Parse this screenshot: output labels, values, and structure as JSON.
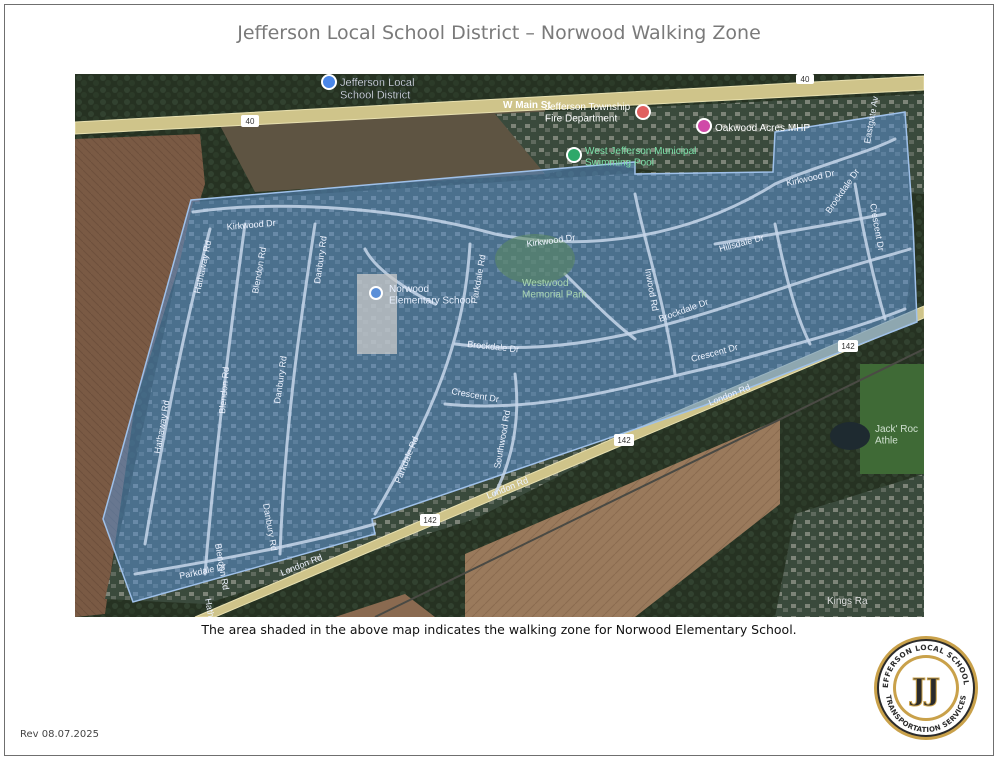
{
  "title": "Jefferson Local School District – Norwood Walking Zone",
  "caption": "The area shaded in the above map indicates the walking zone for Norwood Elementary School.",
  "revision": "Rev 08.07.2025",
  "map": {
    "poi": {
      "district": "Jefferson Local\nSchool District",
      "fire_dept": "Jefferson Township\nFire Department",
      "main_st": "W Main St",
      "oakwood": "Oakwood Acres MHP",
      "pool": "West Jefferson Municipal\nSwimming Pool",
      "school": "Norwood\nElementary School",
      "park": "Westwood\nMemorial Park",
      "jack": "Jack' Roc\nAthle",
      "kings": "Kings Ra"
    },
    "streets": {
      "kirkwood_w": "Kirkwood Dr",
      "kirkwood_e": "Kirkwood Dr",
      "kirkwood_ne": "Kirkwood Dr",
      "hathaway_n": "Hathaway Rd",
      "hathaway_s": "Hathaway Rd",
      "hathaway_mid": "Hathaway Rd",
      "blendon_n": "Blendon Rd",
      "blendon_mid": "Blendon Rd",
      "blendon_s": "Blendon Rd",
      "danbury_n": "Danbury Rd",
      "danbury_mid": "Danbury Rd",
      "danbury_s": "Danbury Rd",
      "parkdale_n": "Parkdale Rd",
      "parkdale_s": "Parkdale Rd",
      "parkdale_dr": "Parkdale Dr",
      "brockdale_w": "Brockdale Dr",
      "brockdale_e": "Brockdale Dr",
      "brockdale_ne": "Brockdale Dr",
      "crescent_w": "Crescent Dr",
      "crescent_e": "Crescent Dr",
      "crescent_ne": "Crescent Dr",
      "hillsdale": "Hillsdale Dr",
      "inwood": "Inwood Rd",
      "southwood": "Southwood Rd",
      "eastgate": "Eastgate Av",
      "london_w": "London Rd",
      "london_mid": "London Rd",
      "london_e": "London Rd"
    },
    "shields": {
      "us40_a": "40",
      "us40_b": "40",
      "sr142_a": "142",
      "sr142_b": "142",
      "sr142_c": "142"
    },
    "colors": {
      "zone_fill": "#5a8fd0",
      "zone_stroke": "#9fc1ea",
      "road": "#d9cf9a",
      "street": "#c7d6ea"
    }
  },
  "logo": {
    "ring_top": "JEFFERSON LOCAL SCHOOLS",
    "ring_bottom": "TRANSPORTATION SERVICES",
    "monogram": "JJ"
  }
}
